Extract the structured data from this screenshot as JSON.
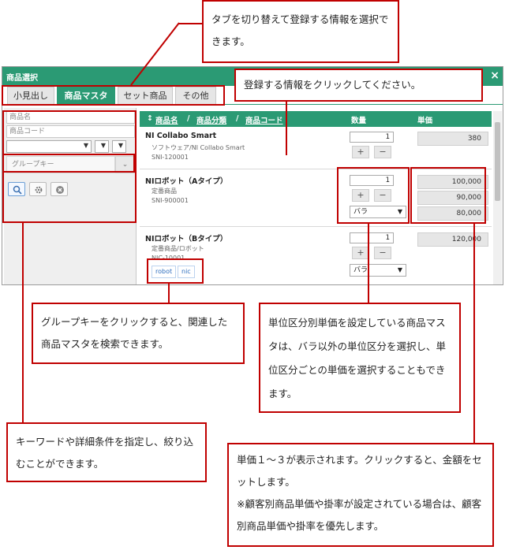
{
  "dialog": {
    "title": "商品選択",
    "close": "×",
    "tabs": [
      "小見出し",
      "商品マスタ",
      "セット商品",
      "その他"
    ]
  },
  "search": {
    "product_name_placeholder": "商品名",
    "product_code_placeholder": "商品コード",
    "group_key_placeholder": "グループキー"
  },
  "list": {
    "header": {
      "sort_icon": "↕",
      "col_name": "商品名",
      "col_category": "商品分類",
      "col_code": "商品コード",
      "sep": "/",
      "col_qty": "数量",
      "col_price": "単価"
    },
    "products": [
      {
        "name": "NI Collabo Smart",
        "category": "ソフトウェア/NI Collabo Smart",
        "code": "SNI-120001",
        "qty": "1",
        "prices": [
          "380"
        ]
      },
      {
        "name": "NIロボット（Aタイプ）",
        "category": "定番商品",
        "code": "SNI-900001",
        "qty": "1",
        "unit": "バラ",
        "prices": [
          "100,000",
          "90,000",
          "80,000"
        ]
      },
      {
        "name": "NIロボット（Bタイプ）",
        "category": "定番商品/ロボット",
        "code": "NIC-10001",
        "qty": "1",
        "unit": "バラ",
        "prices": [
          "120,000"
        ],
        "tags": [
          "robot",
          "nic"
        ]
      }
    ],
    "plus": "+",
    "minus": "−"
  },
  "annotations": {
    "tabs": "タブを切り替えて登録する情報を選択できます。",
    "click_info": "登録する情報をクリックしてください。",
    "group_key": "グループキーをクリックすると、関連した商品マスタを検索できます。",
    "unit_price": "単位区分別単価を設定している商品マスタは、バラ以外の単位区分を選択し、単位区分ごとの単価を選択することもできます。",
    "keyword": "キーワードや詳細条件を指定し、絞り込むことができます。",
    "price": "単価１～３が表示されます。クリックすると、金額をセットします。",
    "price_note": "※顧客別商品単価や掛率が設定されている場合は、顧客別商品単価や掛率を優先します。"
  },
  "colors": {
    "accent": "#2b9a74",
    "annotation": "#c00000"
  }
}
